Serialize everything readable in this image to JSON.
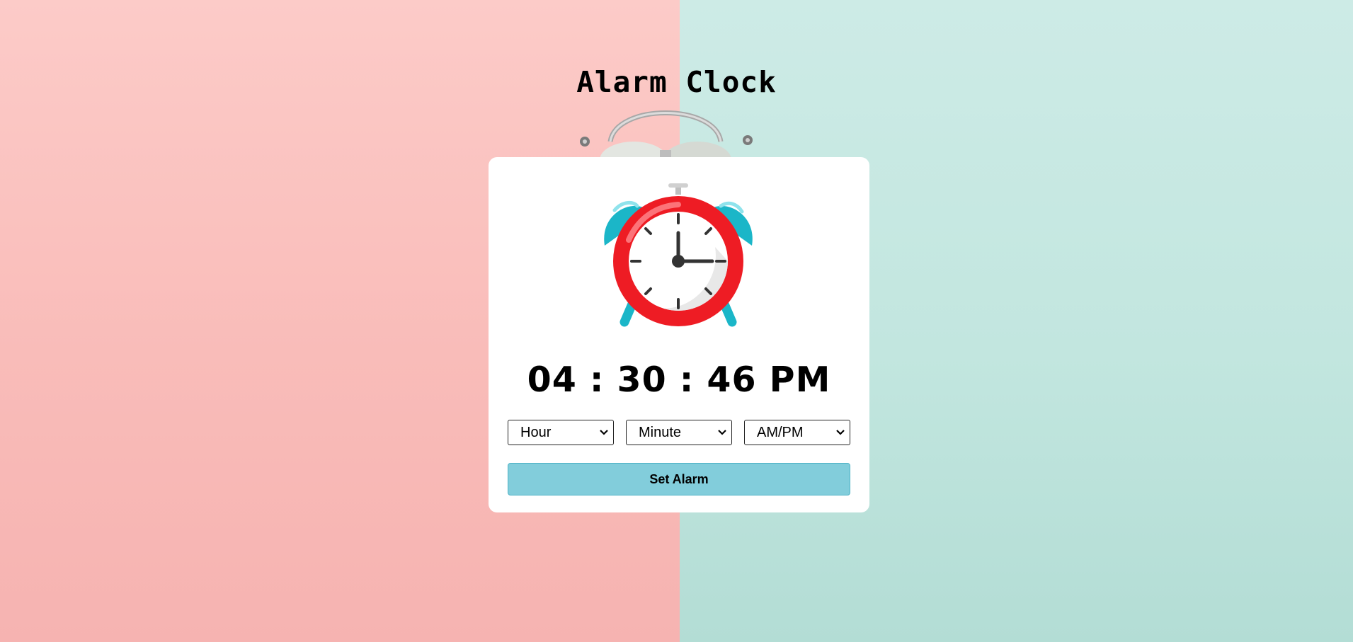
{
  "app": {
    "title": "Alarm Clock"
  },
  "clock": {
    "time": "04 : 30 : 46 PM"
  },
  "selects": {
    "hour": "Hour",
    "minute": "Minute",
    "ampm": "AM/PM"
  },
  "buttons": {
    "set_alarm": "Set Alarm"
  },
  "icons": {
    "background": "alarm-bell-photo",
    "main": "alarm-clock-icon",
    "dropdown": "chevron-down-icon"
  },
  "colors": {
    "left_background": "#f9bcb9",
    "right_background": "#c2e6df",
    "card": "#ffffff",
    "button": "#82cddb",
    "clock_ring": "#ee1c24",
    "clock_bells": "#1bb6c8"
  }
}
